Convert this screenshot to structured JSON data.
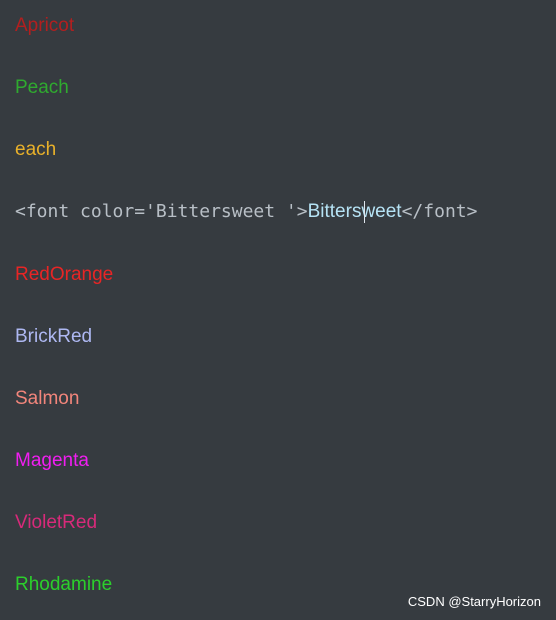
{
  "lines": [
    {
      "text": "Apricot",
      "color": "#b21f1f"
    },
    {
      "text": "Peach",
      "color": "#2faa2f"
    },
    {
      "text": "each",
      "color": "#e8b02a"
    },
    {
      "text": "RedOrange",
      "color": "#e82525"
    },
    {
      "text": "BrickRed",
      "color": "#aeb8f2"
    },
    {
      "text": "Salmon",
      "color": "#f2857b"
    },
    {
      "text": "Magenta",
      "color": "#f01ef0"
    },
    {
      "text": "VioletRed",
      "color": "#d82a7a"
    },
    {
      "text": "Rhodamine",
      "color": "#2ccf2c"
    }
  ],
  "code_line": {
    "open_tag": "<font color='Bittersweet '>",
    "rendered": "Bittersweet ",
    "rendered_color": "#b6e3f5",
    "close_tag": "</font>"
  },
  "watermark": "CSDN @StarryHorizon"
}
